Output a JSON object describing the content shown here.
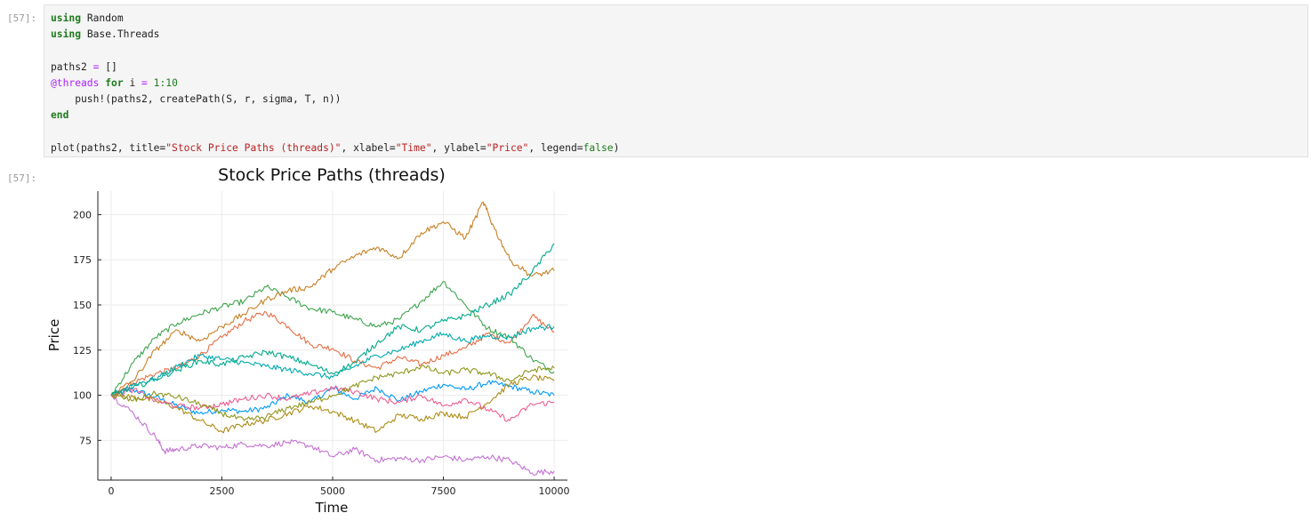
{
  "cell": {
    "in_prompt": "[57]:",
    "out_prompt": "[57]:",
    "code": {
      "l1_kw": "using",
      "l1_rest": " Random",
      "l2_kw": "using",
      "l2_rest": " Base.Threads",
      "l4_a": "paths2 ",
      "l4_op": "=",
      "l4_b": " []",
      "l5_mac": "@threads",
      "l5_kw": " for",
      "l5_a": " i ",
      "l5_op": "=",
      "l5_num": " 1:10",
      "l6": "    push!(paths2, createPath(S, r, sigma, T, n))",
      "l7_kw": "end",
      "l9_a": "plot(paths2, title=",
      "l9_s1": "\"Stock Price Paths (threads)\"",
      "l9_b": ", xlabel=",
      "l9_s2": "\"Time\"",
      "l9_c": ", ylabel=",
      "l9_s3": "\"Price\"",
      "l9_d": ", legend=",
      "l9_bool": "false",
      "l9_e": ")"
    }
  },
  "chart_data": {
    "type": "line",
    "title": "Stock Price Paths (threads)",
    "xlabel": "Time",
    "ylabel": "Price",
    "xlim": [
      -300,
      10300
    ],
    "ylim": [
      53,
      213
    ],
    "xticks": [
      0,
      2500,
      5000,
      7500,
      10000
    ],
    "yticks": [
      75,
      100,
      125,
      150,
      175,
      200
    ],
    "grid": true,
    "legend": false,
    "series": [
      {
        "color": "#009AFA",
        "x": [
          0,
          500,
          1000,
          1500,
          2000,
          2500,
          3000,
          3500,
          4000,
          4500,
          5000,
          5500,
          6000,
          6500,
          7000,
          7500,
          8000,
          8500,
          9000,
          9500,
          10000
        ],
        "y": [
          100,
          103,
          99,
          94,
          90,
          92,
          91,
          93,
          100,
          96,
          104,
          98,
          104,
          97,
          102,
          106,
          103,
          107,
          105,
          102,
          100
        ]
      },
      {
        "color": "#E36F47",
        "x": [
          0,
          500,
          1000,
          1500,
          2000,
          2500,
          3000,
          3500,
          4000,
          4500,
          5000,
          5500,
          6000,
          6500,
          7000,
          7500,
          8000,
          8500,
          9000,
          9500,
          10000
        ],
        "y": [
          100,
          107,
          112,
          115,
          122,
          132,
          141,
          146,
          138,
          128,
          126,
          119,
          115,
          121,
          117,
          122,
          126,
          134,
          129,
          144,
          135
        ]
      },
      {
        "color": "#3EA44E",
        "x": [
          0,
          500,
          1000,
          1500,
          2000,
          2500,
          3000,
          3500,
          4000,
          4500,
          5000,
          5500,
          6000,
          6500,
          7000,
          7500,
          8000,
          8500,
          9000,
          9500,
          10000
        ],
        "y": [
          100,
          118,
          132,
          140,
          145,
          149,
          152,
          160,
          154,
          148,
          146,
          142,
          138,
          142,
          152,
          163,
          150,
          137,
          132,
          120,
          113
        ]
      },
      {
        "color": "#C371D2",
        "x": [
          0,
          500,
          1000,
          1200,
          1500,
          2000,
          2500,
          3000,
          3500,
          4000,
          4500,
          5000,
          5500,
          6000,
          6500,
          7000,
          7500,
          8000,
          8500,
          9000,
          9500,
          10000
        ],
        "y": [
          100,
          90,
          77,
          69,
          70,
          72,
          71,
          73,
          72,
          74,
          72,
          66,
          70,
          64,
          65,
          64,
          66,
          64,
          66,
          64,
          57,
          58
        ]
      },
      {
        "color": "#AC8D18",
        "x": [
          0,
          500,
          1000,
          1500,
          2000,
          2500,
          3000,
          3500,
          4000,
          4500,
          5000,
          5500,
          6000,
          6500,
          7000,
          7500,
          8000,
          8500,
          9000,
          9500,
          10000
        ],
        "y": [
          100,
          99,
          97,
          93,
          86,
          80,
          84,
          86,
          90,
          94,
          91,
          86,
          80,
          89,
          87,
          90,
          88,
          96,
          106,
          110,
          108
        ]
      },
      {
        "color": "#00A9AD",
        "x": [
          0,
          500,
          1000,
          1500,
          2000,
          2500,
          3000,
          3500,
          4000,
          4500,
          5000,
          5500,
          6000,
          6500,
          7000,
          7500,
          8000,
          8500,
          9000,
          9500,
          10000
        ],
        "y": [
          100,
          106,
          109,
          116,
          122,
          120,
          118,
          116,
          114,
          112,
          110,
          116,
          122,
          125,
          130,
          134,
          130,
          133,
          132,
          137,
          138
        ]
      },
      {
        "color": "#ED5D92",
        "x": [
          0,
          500,
          1000,
          1500,
          2000,
          2500,
          3000,
          3500,
          4000,
          4500,
          5000,
          5500,
          6000,
          6500,
          7000,
          7500,
          8000,
          8500,
          9000,
          9500,
          10000
        ],
        "y": [
          100,
          103,
          97,
          94,
          93,
          95,
          98,
          100,
          98,
          101,
          104,
          102,
          98,
          96,
          100,
          94,
          98,
          92,
          86,
          95,
          96
        ]
      },
      {
        "color": "#C68125",
        "x": [
          0,
          500,
          1000,
          1500,
          2000,
          2500,
          3000,
          3500,
          4000,
          4500,
          5000,
          5500,
          6000,
          6500,
          7000,
          7500,
          8000,
          8400,
          8600,
          9000,
          9500,
          10000
        ],
        "y": [
          100,
          108,
          125,
          136,
          130,
          138,
          145,
          153,
          158,
          160,
          170,
          177,
          182,
          176,
          190,
          196,
          187,
          207,
          195,
          175,
          166,
          169
        ]
      },
      {
        "color": "#00A98D",
        "x": [
          0,
          500,
          1000,
          1500,
          2000,
          2500,
          3000,
          3500,
          4000,
          4500,
          5000,
          5500,
          6000,
          6500,
          7000,
          7500,
          8000,
          8500,
          9000,
          9500,
          10000
        ],
        "y": [
          100,
          104,
          109,
          114,
          119,
          117,
          121,
          124,
          121,
          117,
          112,
          118,
          129,
          138,
          136,
          141,
          144,
          150,
          156,
          168,
          184
        ]
      },
      {
        "color": "#8E971D",
        "x": [
          0,
          500,
          1000,
          1500,
          2000,
          2500,
          3000,
          3500,
          4000,
          4500,
          5000,
          5500,
          6000,
          6500,
          7000,
          7500,
          8000,
          8500,
          9000,
          9500,
          10000
        ],
        "y": [
          100,
          97,
          101,
          99,
          95,
          90,
          86,
          88,
          93,
          96,
          100,
          105,
          110,
          112,
          116,
          112,
          114,
          112,
          108,
          114,
          115
        ]
      }
    ]
  }
}
